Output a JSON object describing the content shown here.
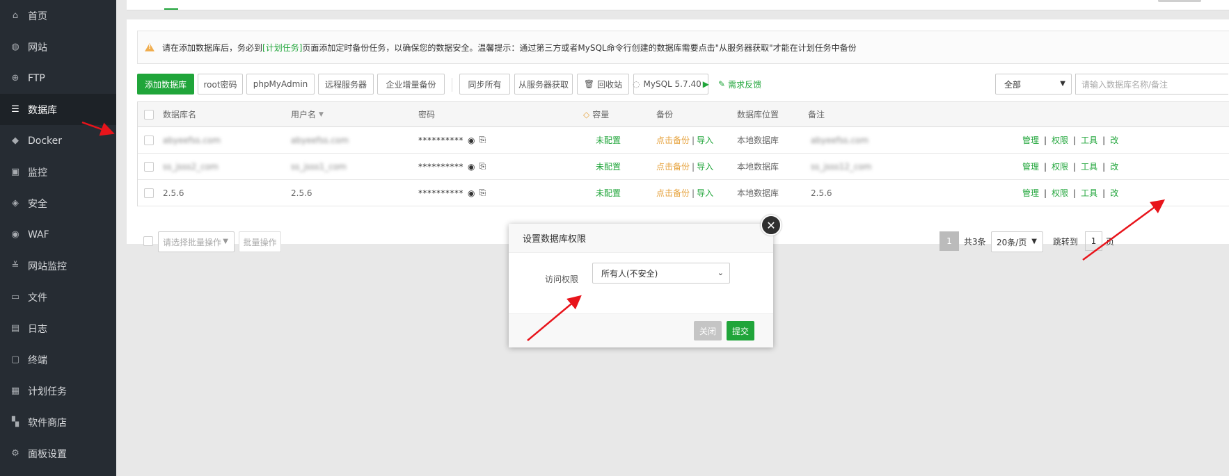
{
  "sidebar": {
    "items": [
      {
        "label": "首页",
        "icon": "home-icon"
      },
      {
        "label": "网站",
        "icon": "globe-icon"
      },
      {
        "label": "FTP",
        "icon": "ftp-icon"
      },
      {
        "label": "数据库",
        "icon": "database-icon"
      },
      {
        "label": "Docker",
        "icon": "docker-icon"
      },
      {
        "label": "监控",
        "icon": "monitor-icon"
      },
      {
        "label": "安全",
        "icon": "shield-icon"
      },
      {
        "label": "WAF",
        "icon": "waf-icon"
      },
      {
        "label": "网站监控",
        "icon": "chart-icon"
      },
      {
        "label": "文件",
        "icon": "folder-icon"
      },
      {
        "label": "日志",
        "icon": "log-icon"
      },
      {
        "label": "终端",
        "icon": "terminal-icon"
      },
      {
        "label": "计划任务",
        "icon": "calendar-icon"
      },
      {
        "label": "软件商店",
        "icon": "apps-icon"
      },
      {
        "label": "面板设置",
        "icon": "gear-icon"
      }
    ],
    "active_index": 3
  },
  "notice": {
    "prefix": "请在添加数据库后，务必到",
    "link": "[计划任务]",
    "suffix": "页面添加定时备份任务，以确保您的数据安全。温馨提示：通过第三方或者MySQL命令行创建的数据库需要点击\"从服务器获取\"才能在计划任务中备份"
  },
  "toolbar": {
    "add_db": "添加数据库",
    "root_pw": "root密码",
    "phpmyadmin": "phpMyAdmin",
    "remote": "远程服务器",
    "incremental": "企业增量备份",
    "sync_all": "同步所有",
    "fetch_server": "从服务器获取",
    "recycle": "回收站",
    "mysql": "MySQL 5.7.40",
    "feedback": "需求反馈",
    "filter_value": "全部",
    "search_placeholder": "请输入数据库名称/备注"
  },
  "table": {
    "headers": {
      "name": "数据库名",
      "user": "用户名",
      "password": "密码",
      "capacity": "容量",
      "backup": "备份",
      "location": "数据库位置",
      "note": "备注"
    },
    "rows": [
      {
        "name": "abyeefss.com",
        "user": "abyeefss.com",
        "password": "**********",
        "capacity": "未配置",
        "backup": "点击备份",
        "import": "导入",
        "location": "本地数据库",
        "note": "abyeefss.com"
      },
      {
        "name": "ss_jsss2_com",
        "user": "ss_jsss1_com",
        "password": "**********",
        "capacity": "未配置",
        "backup": "点击备份",
        "import": "导入",
        "location": "本地数据库",
        "note": "ss_jsss12_com"
      },
      {
        "name": "2.5.6",
        "user": "2.5.6",
        "password": "**********",
        "capacity": "未配置",
        "backup": "点击备份",
        "import": "导入",
        "location": "本地数据库",
        "note": "2.5.6"
      }
    ],
    "ops": {
      "manage": "管理",
      "perm": "权限",
      "tools": "工具",
      "edit": "改"
    },
    "sep": "|"
  },
  "footer": {
    "batch_placeholder": "请选择批量操作",
    "batch_btn": "批量操作",
    "page": "1",
    "total": "共3条",
    "per_page": "20条/页",
    "jump_label": "跳转到",
    "jump_value": "1",
    "page_tail": "页"
  },
  "modal": {
    "title": "设置数据库权限",
    "label": "访问权限",
    "selected": "所有人(不安全)",
    "close_btn": "关闭",
    "submit_btn": "提交"
  },
  "colors": {
    "brand_green": "#20a53a",
    "sidebar_bg": "#262c33",
    "backup_orange": "#e6a23c",
    "annotation_red": "#e8141b"
  }
}
